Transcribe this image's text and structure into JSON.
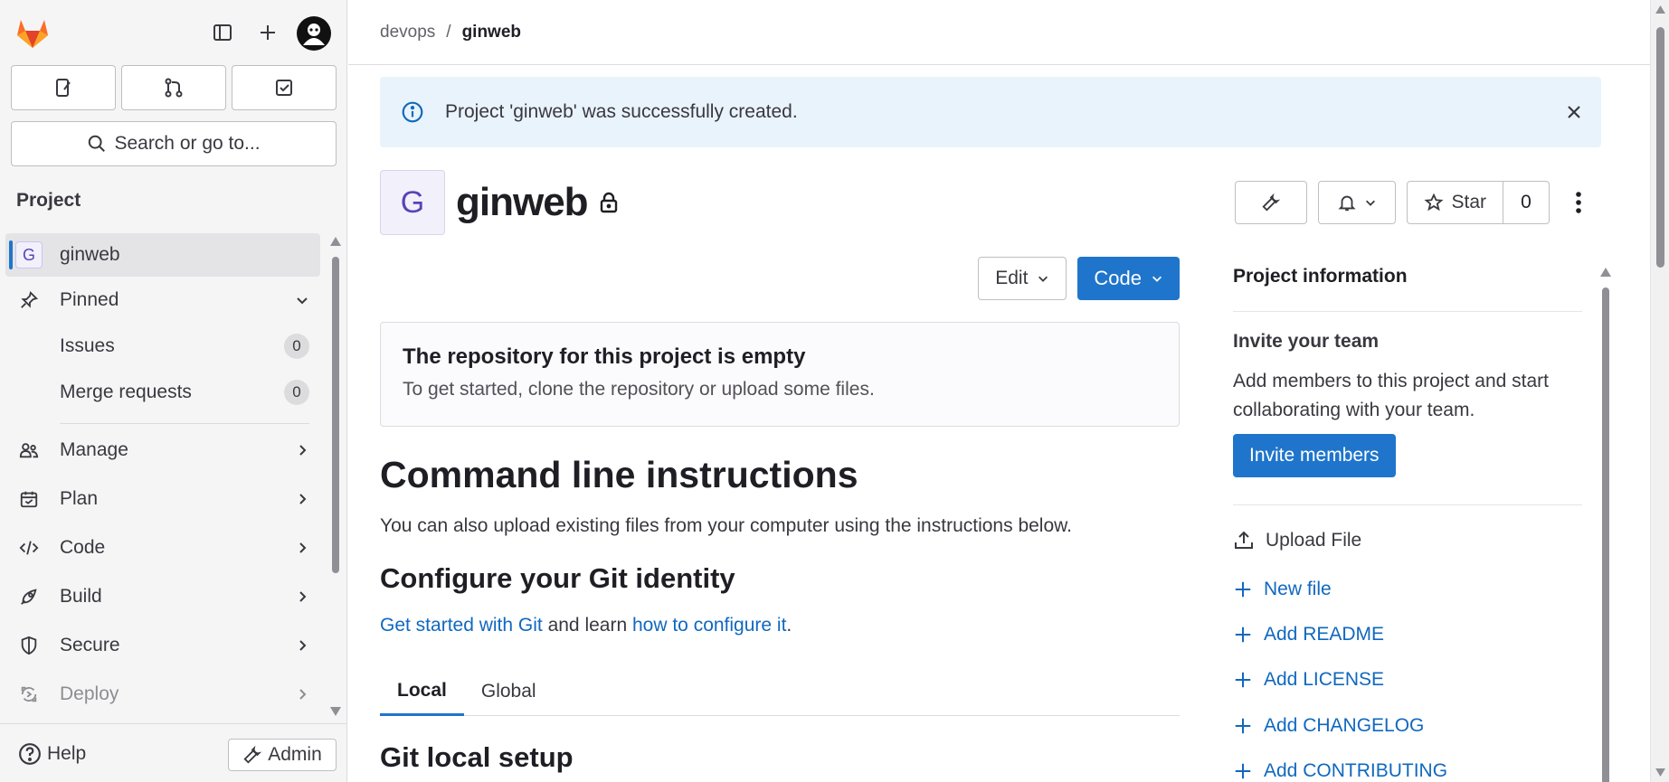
{
  "sidebar": {
    "search_label": "Search or go to...",
    "section_title": "Project",
    "project": {
      "avatar_letter": "G",
      "name": "ginweb"
    },
    "pinned": {
      "label": "Pinned",
      "items": [
        {
          "label": "Issues",
          "count": "0"
        },
        {
          "label": "Merge requests",
          "count": "0"
        }
      ]
    },
    "nav": [
      {
        "label": "Manage",
        "icon": "users-icon"
      },
      {
        "label": "Plan",
        "icon": "calendar-icon"
      },
      {
        "label": "Code",
        "icon": "code-icon"
      },
      {
        "label": "Build",
        "icon": "rocket-icon"
      },
      {
        "label": "Secure",
        "icon": "shield-icon"
      },
      {
        "label": "Deploy",
        "icon": "deploy-icon"
      }
    ],
    "help_label": "Help",
    "admin_label": "Admin"
  },
  "breadcrumb": {
    "parent": "devops",
    "separator": "/",
    "current": "ginweb"
  },
  "alert": {
    "message": "Project 'ginweb' was successfully created."
  },
  "project": {
    "avatar_letter": "G",
    "title": "ginweb",
    "star_label": "Star",
    "star_count": "0"
  },
  "repo": {
    "edit_label": "Edit",
    "code_label": "Code",
    "empty_title": "The repository for this project is empty",
    "empty_text": "To get started, clone the repository or upload some files."
  },
  "instructions": {
    "title": "Command line instructions",
    "intro": "You can also upload existing files from your computer using the instructions below.",
    "configure_title": "Configure your Git identity",
    "link1": "Get started with Git",
    "mid_text": " and learn ",
    "link2": "how to configure it",
    "end_text": ".",
    "tabs": [
      "Local",
      "Global"
    ],
    "local_setup_title": "Git local setup"
  },
  "project_info": {
    "title": "Project information",
    "invite_title": "Invite your team",
    "invite_text": "Add members to this project and start collaborating with your team.",
    "invite_button": "Invite members",
    "upload_file": "Upload File",
    "links": [
      "New file",
      "Add README",
      "Add LICENSE",
      "Add CHANGELOG",
      "Add CONTRIBUTING"
    ]
  },
  "colors": {
    "primary": "#1f75cb",
    "link": "#1068bf",
    "alert_bg": "#e9f3fc",
    "sidebar_bg": "#f5f5f6"
  }
}
